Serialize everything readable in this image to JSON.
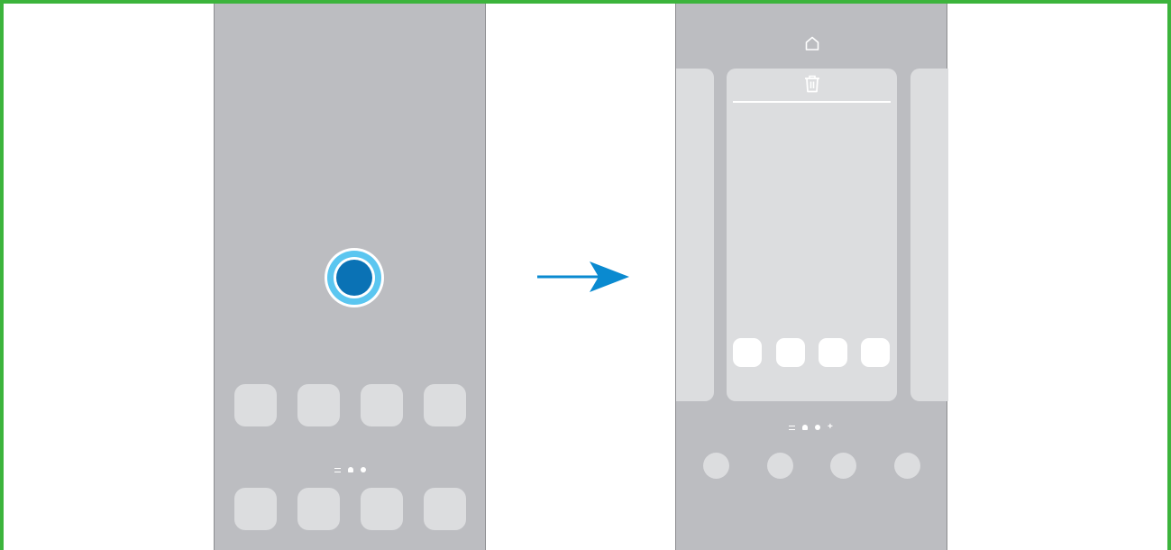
{
  "colors": {
    "frame_border": "#3cb43c",
    "phone_background": "#bcbdc1",
    "tile": "#dcdddf",
    "touch_indicator_fill": "#0a72b5",
    "touch_indicator_ring": "#5bc6f0",
    "arrow": "#0a8ad0"
  },
  "left_screen": {
    "gesture": "long-press",
    "app_row_top_count": 4,
    "app_row_bottom_count": 4,
    "page_indicators": [
      "lines",
      "home",
      "dot"
    ]
  },
  "right_screen": {
    "top_icon": "home-icon",
    "panel_icon": "trash-icon",
    "panel_app_count": 4,
    "page_indicators": [
      "lines",
      "home",
      "dot",
      "plus"
    ],
    "dock_item_count": 4
  }
}
